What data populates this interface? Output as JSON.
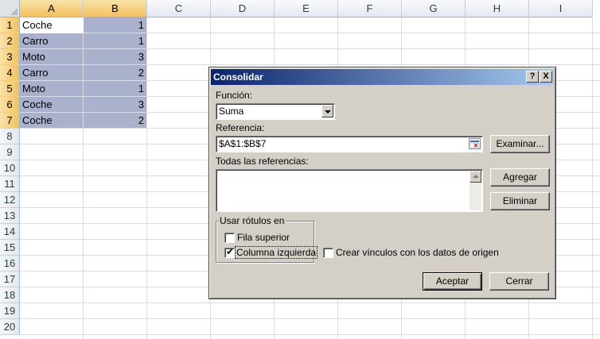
{
  "sheet": {
    "columns": [
      "A",
      "B",
      "C",
      "D",
      "E",
      "F",
      "G",
      "H",
      "I"
    ],
    "rows": [
      "1",
      "2",
      "3",
      "4",
      "5",
      "6",
      "7",
      "8",
      "9",
      "10",
      "11",
      "12",
      "13",
      "14",
      "15",
      "16",
      "17",
      "18",
      "19",
      "20"
    ],
    "data": [
      {
        "a": "Coche",
        "b": "1"
      },
      {
        "a": "Carro",
        "b": "1"
      },
      {
        "a": "Moto",
        "b": "3"
      },
      {
        "a": "Carro",
        "b": "2"
      },
      {
        "a": "Moto",
        "b": "1"
      },
      {
        "a": "Coche",
        "b": "3"
      },
      {
        "a": "Coche",
        "b": "2"
      }
    ],
    "selection_color": "#a9b1cc"
  },
  "dialog": {
    "title": "Consolidar",
    "help_label": "?",
    "close_label": "X",
    "function_label": "Función:",
    "function_value": "Suma",
    "reference_label": "Referencia:",
    "reference_value": "$A$1:$B$7",
    "browse_label": "Examinar...",
    "all_refs_label": "Todas las referencias:",
    "add_label": "Agregar",
    "delete_label": "Eliminar",
    "use_labels_group": "Usar rótulos en",
    "top_row_label": "Fila superior",
    "top_row_checked": false,
    "left_column_label": "Columna izquierda",
    "left_column_checked": true,
    "create_links_label": "Crear vínculos con los datos de origen",
    "create_links_checked": false,
    "ok_label": "Aceptar",
    "close_button_label": "Cerrar",
    "check_mark": "✔"
  }
}
